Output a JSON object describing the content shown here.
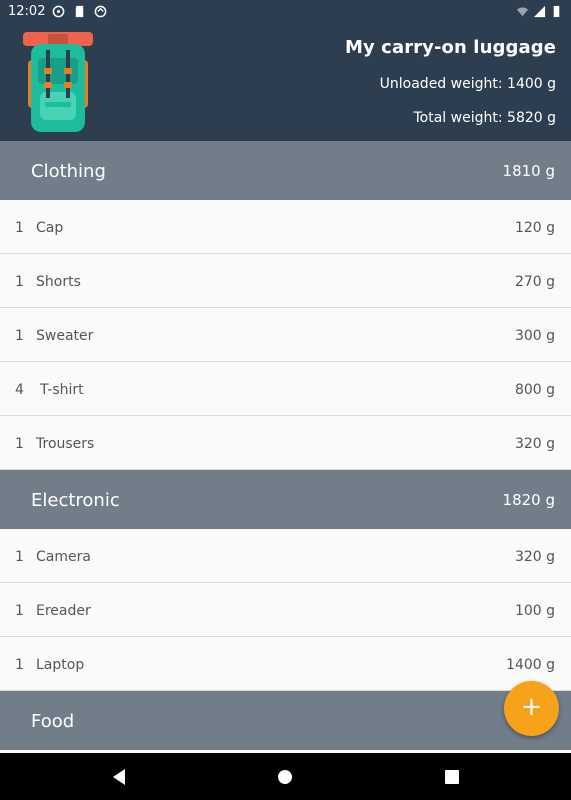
{
  "status_bar": {
    "time": "12:02",
    "icons": [
      "steering-wheel-icon",
      "sd-card-icon",
      "sync-icon"
    ],
    "right_icons": [
      "wifi-icon",
      "signal-icon",
      "battery-icon"
    ]
  },
  "header": {
    "title": "My carry-on luggage",
    "unloaded_label": "Unloaded weight:",
    "unloaded_value": "1400 g",
    "total_label": "Total weight:",
    "total_value": "5820 g"
  },
  "categories": [
    {
      "name": "Clothing",
      "weight": "1810 g",
      "items": [
        {
          "qty": "1",
          "name": "Cap",
          "weight": "120 g"
        },
        {
          "qty": "1",
          "name": "Shorts",
          "weight": "270 g"
        },
        {
          "qty": "1",
          "name": "Sweater",
          "weight": "300 g"
        },
        {
          "qty": "4",
          "name": "T-shirt",
          "weight": "800 g"
        },
        {
          "qty": "1",
          "name": "Trousers",
          "weight": "320 g"
        }
      ]
    },
    {
      "name": "Electronic",
      "weight": "1820 g",
      "items": [
        {
          "qty": "1",
          "name": "Camera",
          "weight": "320 g"
        },
        {
          "qty": "1",
          "name": "Ereader",
          "weight": "100 g"
        },
        {
          "qty": "1",
          "name": "Laptop",
          "weight": "1400 g"
        }
      ]
    },
    {
      "name": "Food",
      "weight": "",
      "items": []
    }
  ],
  "fab": {
    "label": "+",
    "icon": "add-icon"
  },
  "colors": {
    "header_bg": "#2d3e50",
    "category_bg": "#727d8a",
    "fab": "#f7a21b",
    "row_bg": "#fafafa"
  },
  "navigation": {
    "icons": [
      "back-icon",
      "home-icon",
      "recents-icon"
    ]
  }
}
